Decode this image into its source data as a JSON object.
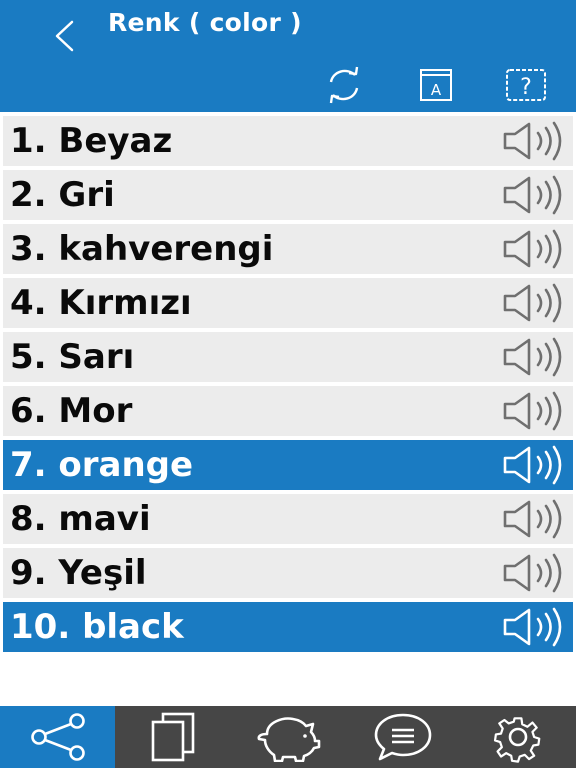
{
  "header": {
    "title": "Renk ( color )",
    "tools": [
      {
        "name": "refresh-icon"
      },
      {
        "name": "dictionary-icon",
        "glyph": "A"
      },
      {
        "name": "help-icon",
        "glyph": "?"
      }
    ]
  },
  "words": [
    {
      "label": "1. Beyaz",
      "active": false
    },
    {
      "label": "2. Gri",
      "active": false
    },
    {
      "label": "3. kahverengi",
      "active": false
    },
    {
      "label": "4. Kırmızı",
      "active": false
    },
    {
      "label": "5. Sarı",
      "active": false
    },
    {
      "label": "6. Mor",
      "active": false
    },
    {
      "label": "7. orange",
      "active": true
    },
    {
      "label": "8. mavi",
      "active": false
    },
    {
      "label": "9. Yeşil",
      "active": false
    },
    {
      "label": "10. black",
      "active": true
    }
  ],
  "tabbar": {
    "tabs": [
      {
        "icon": "share-icon",
        "active": true
      },
      {
        "icon": "cards-icon",
        "active": false
      },
      {
        "icon": "piggy-bank-icon",
        "active": false
      },
      {
        "icon": "chat-icon",
        "active": false
      },
      {
        "icon": "settings-icon",
        "active": false
      }
    ]
  },
  "colors": {
    "accent": "#1a7bc2",
    "row_background": "#ececec",
    "tabbar_background": "#464646"
  }
}
